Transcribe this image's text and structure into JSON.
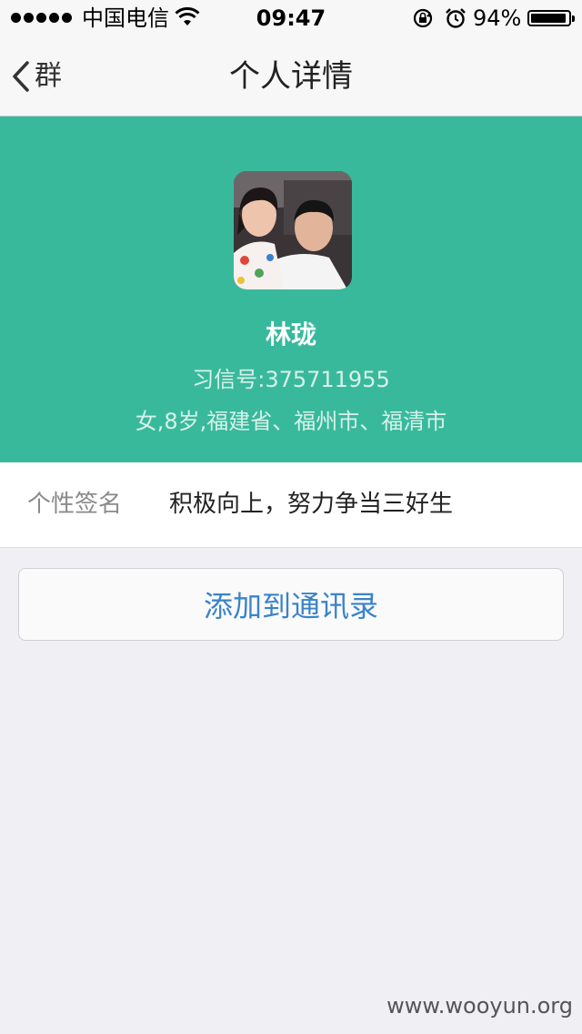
{
  "status_bar": {
    "carrier": "中国电信",
    "time": "09:47",
    "battery_percent": "94%",
    "battery_level": 0.94,
    "icons": [
      "signal-dots-icon",
      "wifi-icon",
      "rotation-lock-icon",
      "alarm-icon",
      "battery-icon"
    ]
  },
  "nav": {
    "back_label": "群",
    "title": "个人详情"
  },
  "profile": {
    "name": "林珑",
    "id_line": "习信号:375711955",
    "info_line": "女,8岁,福建省、福州市、福清市",
    "header_color": "#39b99c"
  },
  "signature": {
    "label": "个性签名",
    "value": "积极向上，努力争当三好生"
  },
  "actions": {
    "add_contact_label": "添加到通讯录",
    "accent_color": "#3a83c9"
  },
  "watermark": "www.wooyun.org"
}
